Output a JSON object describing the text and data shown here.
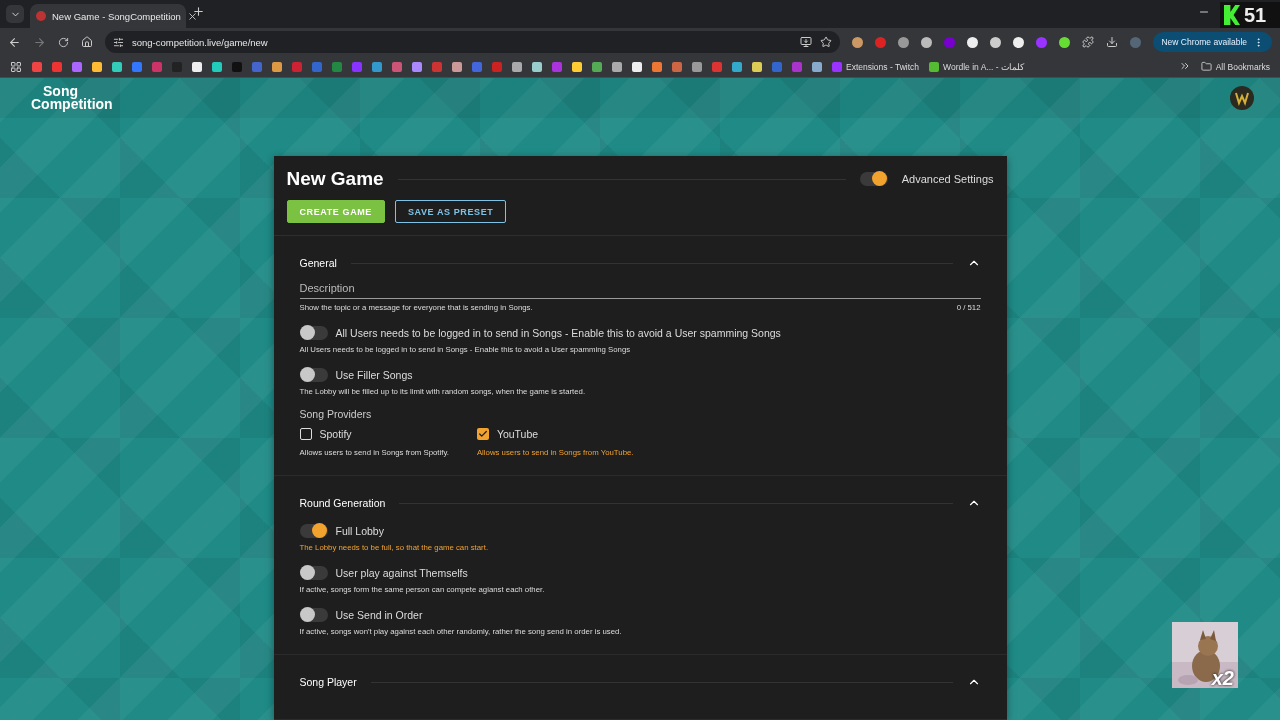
{
  "browser": {
    "tab_title": "New Game - SongCompetition",
    "url": "song-competition.live/game/new",
    "update_button": "New Chrome available",
    "bookmarks": [
      {
        "label": "Extensions - Twitch"
      },
      {
        "label": "Wordle in A... - كلمات"
      }
    ],
    "all_bookmarks": "All Bookmarks"
  },
  "overlay": {
    "counter": "51",
    "webcam_badge": "x2"
  },
  "app": {
    "logo": {
      "line1": "Song",
      "line2": "Competition"
    }
  },
  "form": {
    "title": "New Game",
    "advanced_settings": {
      "label": "Advanced Settings",
      "on": true
    },
    "buttons": [
      {
        "label": "CREATE GAME",
        "kind": "primary"
      },
      {
        "label": "SAVE AS PRESET",
        "kind": "outlined"
      }
    ],
    "sections": [
      {
        "title": "General",
        "expanded": true,
        "items": [
          {
            "kind": "text_field",
            "label": "Description",
            "helper": "Show the topic or a message for everyone that is sending in Songs.",
            "counter": "0 / 512"
          },
          {
            "kind": "switch",
            "label": "All Users needs to be logged in to send in Songs - Enable this to avoid a User spamming Songs",
            "helper": "All Users needs to be logged in to send in Songs - Enable this to avoid a User spamming Songs",
            "on": false
          },
          {
            "kind": "switch",
            "label": "Use Filler Songs",
            "helper": "The Lobby will be filled up to its limit with random songs, when the game is started.",
            "on": false
          },
          {
            "kind": "checkbox_group",
            "label": "Song Providers",
            "options": [
              {
                "label": "Spotify",
                "checked": false,
                "helper": "Allows users to send in Songs from Spotify."
              },
              {
                "label": "YouTube",
                "checked": true,
                "helper": "Allows users to send in Songs from YouTube."
              }
            ]
          }
        ]
      },
      {
        "title": "Round Generation",
        "expanded": true,
        "items": [
          {
            "kind": "switch",
            "label": "Full Lobby",
            "helper": "The Lobby needs to be full, so that the game can start.",
            "on": true
          },
          {
            "kind": "switch",
            "label": "User play against Themselfs",
            "helper": "If active, songs form the same person can compete agianst each other.",
            "on": false
          },
          {
            "kind": "switch",
            "label": "Use Send in Order",
            "helper": "If active, songs won't play against each other randomly, rather the song send in order is used.",
            "on": false
          }
        ]
      },
      {
        "title": "Song Player",
        "expanded": true
      }
    ]
  }
}
